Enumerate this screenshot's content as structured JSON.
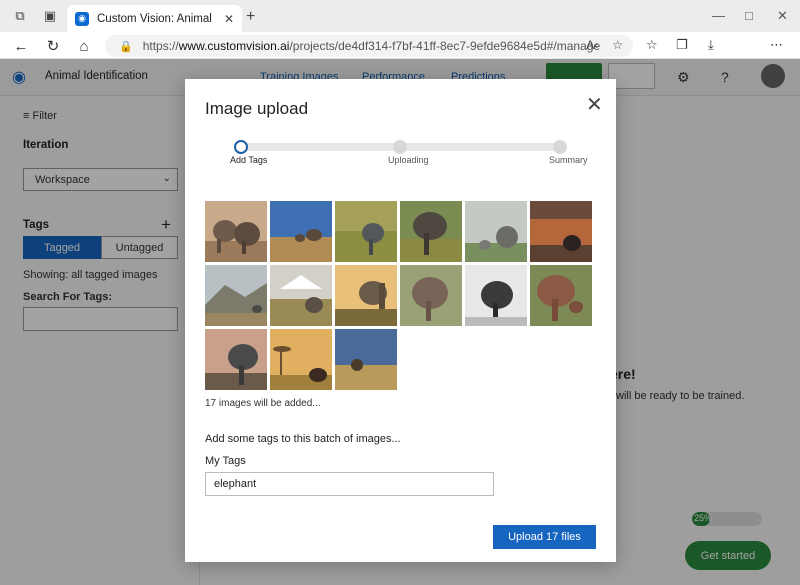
{
  "browser": {
    "tab_title": "Custom Vision: Animal Identification",
    "url_prefix": "https://",
    "url_domain": "www.customvision.ai",
    "url_path": "/projects/de4df314-f7bf-41ff-8ec7-9efde9684e5d#/manage"
  },
  "app": {
    "project_title": "Animal Identification",
    "nav": [
      "Training Images",
      "Performance",
      "Predictions"
    ]
  },
  "sidebar": {
    "filter_label": "Filter",
    "iteration_heading": "Iteration",
    "iteration_value": "Workspace",
    "tags_heading": "Tags",
    "tagged_label": "Tagged",
    "untagged_label": "Untagged",
    "showing_text": "Showing: all tagged images",
    "search_label": "Search For Tags:"
  },
  "main": {
    "hint_title": "ere!",
    "hint_text": "will be ready to be trained.",
    "progress_percent": 25,
    "progress_label": "25%",
    "get_started_label": "Get started"
  },
  "modal": {
    "title": "Image upload",
    "steps": [
      "Add Tags",
      "Uploading",
      "Summary"
    ],
    "active_step": 0,
    "image_count_text": "17 images will be added...",
    "batch_prompt": "Add some tags to this batch of images...",
    "tags_label": "My Tags",
    "tags_value": "elephant",
    "upload_label": "Upload 17 files"
  },
  "colors": {
    "accent": "#1666c1",
    "success": "#2b8a3e"
  }
}
